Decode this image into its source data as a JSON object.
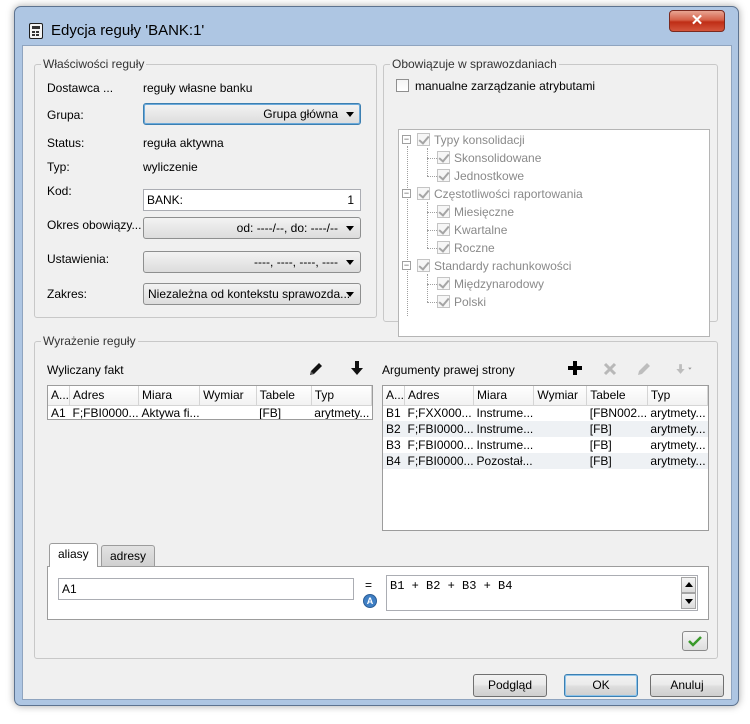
{
  "window": {
    "title": "Edycja reguły 'BANK:1'",
    "close_glyph": "✕"
  },
  "properties": {
    "legend": "Właściwości reguły",
    "supplier_label": "Dostawca ...",
    "supplier_value": "reguły własne banku",
    "group_label": "Grupa:",
    "group_value": "Grupa główna",
    "status_label": "Status:",
    "status_value": "reguła aktywna",
    "type_label": "Typ:",
    "type_value": "wyliczenie",
    "code_label": "Kod:",
    "code_value": "BANK:",
    "code_number": "1",
    "period_label": "Okres obowiązy...",
    "period_value": "od: ----/--, do: ----/--",
    "settings_label": "Ustawienia:",
    "settings_value": "----, ----, ----, ----",
    "scope_label": "Zakres:",
    "scope_value": "Niezależna od kontekstu sprawozda..."
  },
  "reports": {
    "legend": "Obowiązuje w sprawozdaniach",
    "manual_label": "manualne zarządzanie atrybutami",
    "tree": [
      {
        "label": "Typy konsolidacji",
        "level": 0
      },
      {
        "label": "Skonsolidowane",
        "level": 1
      },
      {
        "label": "Jednostkowe",
        "level": 1
      },
      {
        "label": "Częstotliwości raportowania",
        "level": 0
      },
      {
        "label": "Miesięczne",
        "level": 1
      },
      {
        "label": "Kwartalne",
        "level": 1
      },
      {
        "label": "Roczne",
        "level": 1
      },
      {
        "label": "Standardy rachunkowości",
        "level": 0
      },
      {
        "label": "Międzynarodowy",
        "level": 1
      },
      {
        "label": "Polski",
        "level": 1
      }
    ]
  },
  "expression": {
    "legend": "Wyrażenie reguły",
    "computed_fact_label": "Wyliczany fakt",
    "right_args_label": "Argumenty prawej strony",
    "columns": [
      "A...",
      "Adres",
      "Miara",
      "Wymiar",
      "Tabele",
      "Typ"
    ],
    "left_rows": [
      {
        "a": "A1",
        "adres": "F;FBI0000...",
        "miara": "Aktywa fi...",
        "wymiar": "",
        "tabele": "[FB]",
        "typ": "arytmety..."
      }
    ],
    "right_rows": [
      {
        "a": "B1",
        "adres": "F;FXX000...",
        "miara": "Instrume...",
        "wymiar": "",
        "tabele": "[FBN002...",
        "typ": "arytmety..."
      },
      {
        "a": "B2",
        "adres": "F;FBI0000...",
        "miara": "Instrume...",
        "wymiar": "",
        "tabele": "[FB]",
        "typ": "arytmety..."
      },
      {
        "a": "B3",
        "adres": "F;FBI0000...",
        "miara": "Instrume...",
        "wymiar": "",
        "tabele": "[FB]",
        "typ": "arytmety..."
      },
      {
        "a": "B4",
        "adres": "F;FBI0000...",
        "miara": "Pozostał...",
        "wymiar": "",
        "tabele": "[FB]",
        "typ": "arytmety..."
      }
    ],
    "tabs": [
      "aliasy",
      "adresy"
    ],
    "lhs": "A1",
    "equals": "=",
    "badge": "A",
    "rhs": "B1 + B2 + B3 + B4"
  },
  "buttons": {
    "preview": "Podgląd",
    "ok": "OK",
    "cancel": "Anuluj"
  }
}
